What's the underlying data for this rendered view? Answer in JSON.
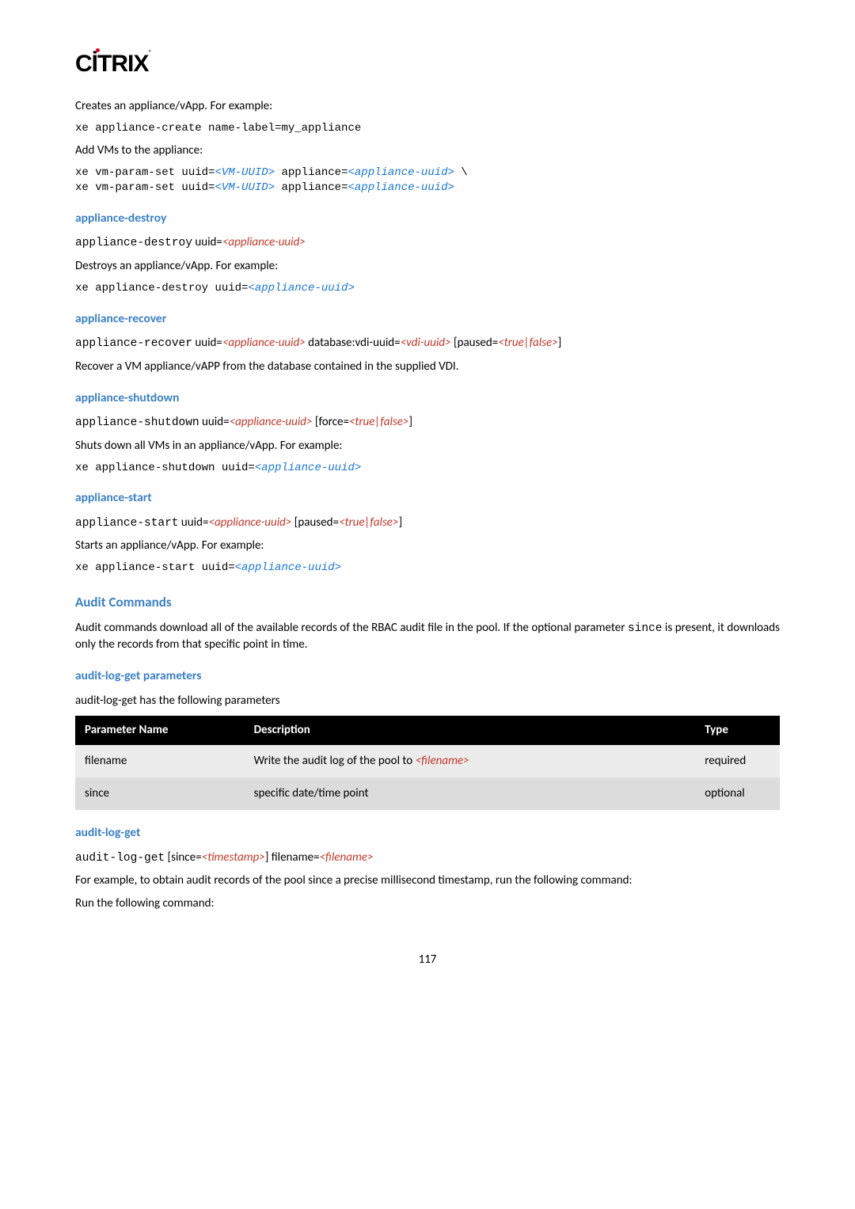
{
  "logo": {
    "text": "CİTRIX",
    "reg": "®"
  },
  "p1": "Creates an appliance/vApp. For example:",
  "code1": "xe appliance-create name-label=my_appliance",
  "p2": "Add VMs to the appliance:",
  "code2_l1_a": "xe vm-param-set uuid=",
  "code2_l1_b": "<VM-UUID>",
  "code2_l1_c": " appliance=",
  "code2_l1_d": "<appliance-uuid>",
  "code2_l1_e": " \\",
  "code2_l2_a": "xe vm-param-set uuid=",
  "code2_l2_b": "<VM-UUID>",
  "code2_l2_c": " appliance=",
  "code2_l2_d": "<appliance-uuid>",
  "h_destroy": "appliance-destroy",
  "destroy_cmd_a": "appliance-destroy",
  "destroy_cmd_b": " uuid=",
  "destroy_cmd_c": "<appliance-uuid>",
  "p3": "Destroys an appliance/vApp. For example:",
  "code3_a": "xe appliance-destroy uuid=",
  "code3_b": "<appliance-uuid>",
  "h_recover": "appliance-recover",
  "recover_cmd_a": "appliance-recover",
  "recover_cmd_b": " uuid=",
  "recover_cmd_c": "<appliance-uuid>",
  "recover_cmd_d": " database:vdi-uuid=",
  "recover_cmd_e": "<vdi-uuid>",
  "recover_cmd_f": " [paused=",
  "recover_cmd_g": "<true|false>",
  "recover_cmd_h": "]",
  "p4": "Recover a VM appliance/vAPP from the database contained in the supplied VDI.",
  "h_shutdown": "appliance-shutdown",
  "shutdown_cmd_a": "appliance-shutdown",
  "shutdown_cmd_b": " uuid=",
  "shutdown_cmd_c": "<appliance-uuid>",
  "shutdown_cmd_d": " [force=",
  "shutdown_cmd_e": "<true|false>",
  "shutdown_cmd_f": "]",
  "p5": "Shuts down all VMs in an appliance/vApp. For example:",
  "code5_a": "xe appliance-shutdown uuid=",
  "code5_b": "<appliance-uuid>",
  "h_start": "appliance-start",
  "start_cmd_a": "appliance-start",
  "start_cmd_b": " uuid=",
  "start_cmd_c": "<appliance-uuid>",
  "start_cmd_d": " [paused=",
  "start_cmd_e": "<true|false>",
  "start_cmd_f": "]",
  "p6": "Starts an appliance/vApp. For example:",
  "code6_a": "xe appliance-start uuid=",
  "code6_b": "<appliance-uuid>",
  "h_audit": "Audit Commands",
  "p7_a": "Audit commands download all of the available records of the RBAC audit file in the pool. If the optional parameter ",
  "p7_b": "since",
  "p7_c": " is present, it downloads only the records from that specific point in time.",
  "h_audit_params": "audit-log-get parameters",
  "p8": "audit-log-get has the following parameters",
  "table": {
    "headers": [
      "Parameter Name",
      "Description",
      "Type"
    ],
    "rows": [
      {
        "name": "filename",
        "desc_a": "Write the audit log of the pool to ",
        "desc_b": "<filename>",
        "type": "required"
      },
      {
        "name": "since",
        "desc_a": "specific date/time point",
        "desc_b": "",
        "type": "optional"
      }
    ]
  },
  "h_audit_get": "audit-log-get",
  "auditget_cmd_a": "audit-log-get",
  "auditget_cmd_b": " [since=",
  "auditget_cmd_c": "<timestamp>",
  "auditget_cmd_d": "] filename=",
  "auditget_cmd_e": "<filename>",
  "p9": "For example, to obtain audit records of the pool since a precise millisecond timestamp, run the following command:",
  "p10": "Run the following command:",
  "page": "117"
}
